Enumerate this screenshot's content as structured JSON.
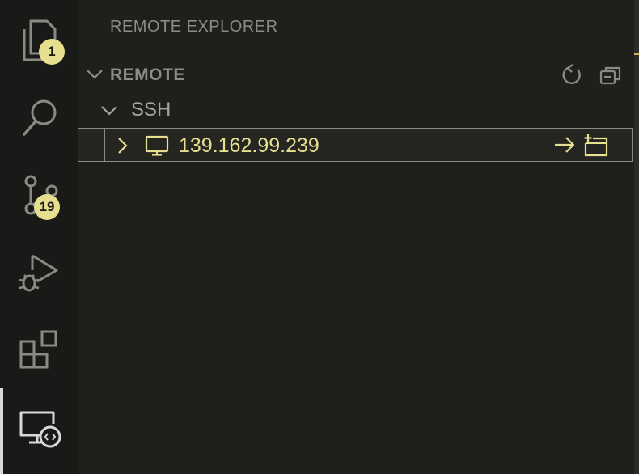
{
  "activity_bar": {
    "items": [
      {
        "name": "explorer",
        "badge": "1"
      },
      {
        "name": "search"
      },
      {
        "name": "source-control",
        "badge": "19"
      },
      {
        "name": "run-and-debug"
      },
      {
        "name": "extensions"
      },
      {
        "name": "remote-explorer",
        "active": true
      }
    ]
  },
  "panel": {
    "title": "REMOTE EXPLORER",
    "section": {
      "title": "REMOTE",
      "actions": [
        "refresh-icon",
        "collapse-all-icon"
      ]
    },
    "group": {
      "label": "SSH",
      "hosts": [
        {
          "label": "139.162.99.239",
          "actions": [
            "connect-in-current-window-icon",
            "connect-in-new-window-icon"
          ]
        }
      ]
    }
  },
  "colors": {
    "background": "#1f1f1c",
    "activity_bar": "#191917",
    "accent": "#e6df8f",
    "muted_text": "#8c8c86",
    "icon": "#8a8a84"
  }
}
